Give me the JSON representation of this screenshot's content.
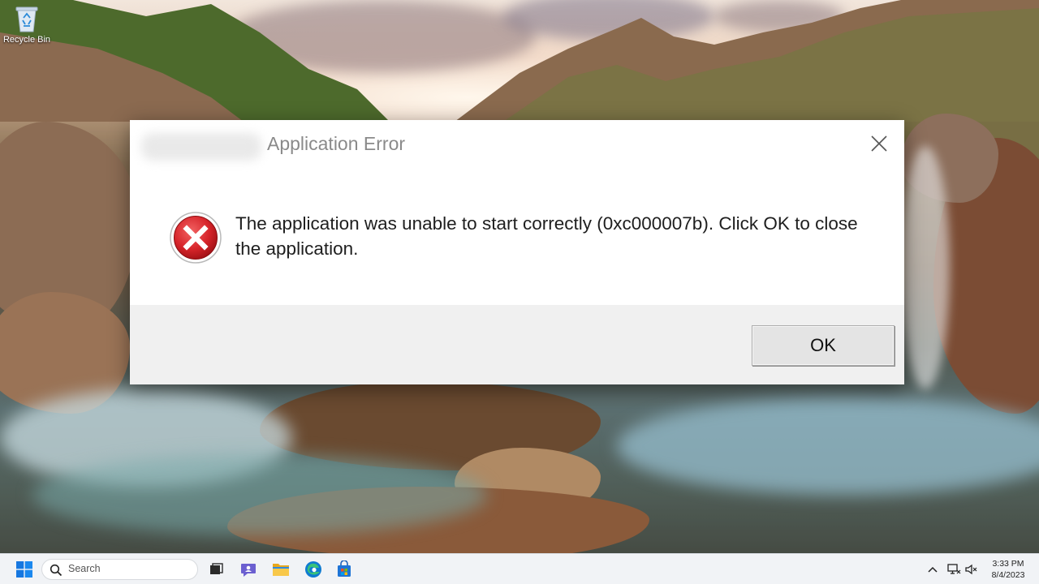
{
  "desktop": {
    "icons": [
      {
        "label": "Recycle Bin",
        "icon": "recycle-bin-icon"
      }
    ]
  },
  "dialog": {
    "title": "Application Error",
    "title_owner_blurred": true,
    "message": "The application was unable to start correctly (0xc000007b). Click OK to close the application.",
    "icon": "error-icon",
    "ok_label": "OK",
    "close_icon": "close-icon"
  },
  "taskbar": {
    "start_icon": "windows-start-icon",
    "search_placeholder": "Search",
    "pinned": [
      {
        "name": "task-view",
        "icon": "task-view-icon"
      },
      {
        "name": "chat",
        "icon": "chat-icon"
      },
      {
        "name": "file-explorer",
        "icon": "folder-icon"
      },
      {
        "name": "edge",
        "icon": "edge-icon"
      },
      {
        "name": "store",
        "icon": "store-icon"
      }
    ],
    "tray": {
      "icons": [
        "chevron-up-icon",
        "network-icon",
        "speaker-muted-icon"
      ],
      "time": "3:33 PM",
      "date": "8/4/2023"
    }
  },
  "colors": {
    "error_red": "#d6242a",
    "dialog_bg": "#ffffff",
    "footer_bg": "#f0f0f0",
    "taskbar_bg": "#f1f3f6",
    "accent_blue": "#0a64c8"
  }
}
